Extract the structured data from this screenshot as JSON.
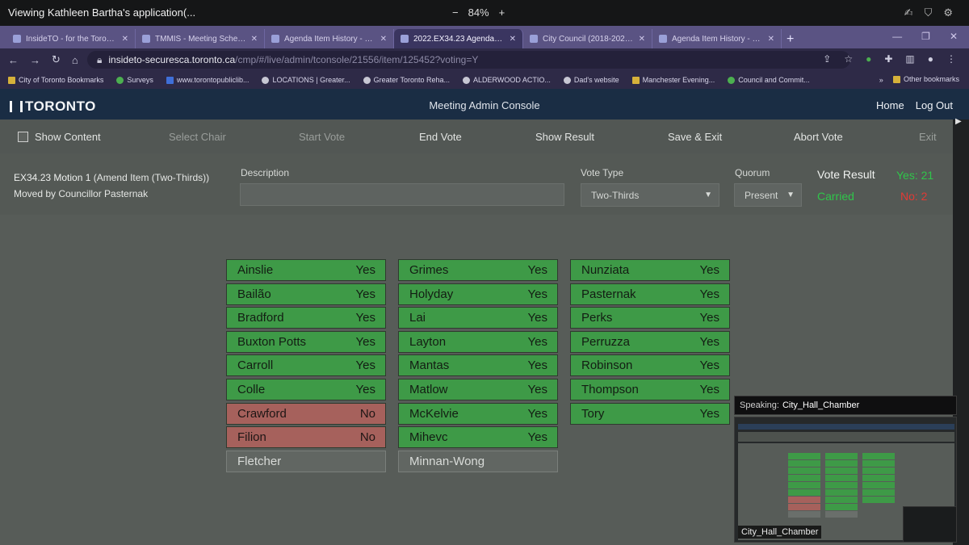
{
  "share_bar": {
    "title": "Viewing Kathleen Bartha's application(...",
    "zoom_minus": "−",
    "zoom_level": "84%",
    "zoom_plus": "+"
  },
  "tabs": [
    {
      "label": "InsideTO - for the Toronto P...",
      "active": false
    },
    {
      "label": "TMMIS - Meeting Schedule",
      "active": false
    },
    {
      "label": "Agenda Item History - 2022...",
      "active": false
    },
    {
      "label": "2022.EX34.23 Agenda Item...",
      "active": true
    },
    {
      "label": "City Council (2018-2022) -",
      "active": false
    },
    {
      "label": "Agenda Item History - 2022...",
      "active": false
    }
  ],
  "address": {
    "host": "insideto-securesca.toronto.ca",
    "path": "/cmp/#/live/admin/tconsole/21556/item/125452?voting=Y"
  },
  "bookmarks": [
    {
      "label": "City of Toronto Bookmarks",
      "icon": "folder-icon"
    },
    {
      "label": "Surveys",
      "icon": "globe-icon"
    },
    {
      "label": "www.torontopubliclib...",
      "icon": "library-icon"
    },
    {
      "label": "LOCATIONS | Greater...",
      "icon": "link-icon"
    },
    {
      "label": "Greater Toronto Reha...",
      "icon": "link-icon"
    },
    {
      "label": "ALDERWOOD ACTIO...",
      "icon": "link-icon"
    },
    {
      "label": "Dad's website",
      "icon": "globe-icon"
    },
    {
      "label": "Manchester Evening...",
      "icon": "news-icon"
    },
    {
      "label": "Council and Commit...",
      "icon": "globe-icon"
    }
  ],
  "bookmarks_more": "»",
  "other_bookmarks": "Other bookmarks",
  "header": {
    "logo": "TORONTO",
    "title": "Meeting Admin Console",
    "home": "Home",
    "logout": "Log Out"
  },
  "toolbar": {
    "show_content": "Show Content",
    "select_chair": "Select Chair",
    "start_vote": "Start Vote",
    "end_vote": "End Vote",
    "show_result": "Show Result",
    "save_exit": "Save & Exit",
    "abort_vote": "Abort Vote",
    "exit": "Exit"
  },
  "motion": {
    "id": "EX34.23 Motion 1",
    "type": "(Amend Item (Two-Thirds))",
    "moved_by": "Moved by Councillor Pasternak",
    "description_label": "Description",
    "description_value": "",
    "vote_type_label": "Vote Type",
    "vote_type_value": "Two-Thirds",
    "quorum_label": "Quorum",
    "quorum_value": "Present",
    "result_label": "Vote Result",
    "yes": "Yes: 21",
    "no": "No: 2",
    "status": "Carried"
  },
  "columns": [
    [
      {
        "name": "Ainslie",
        "vote": "Yes"
      },
      {
        "name": "Bailão",
        "vote": "Yes"
      },
      {
        "name": "Bradford",
        "vote": "Yes"
      },
      {
        "name": "Buxton Potts",
        "vote": "Yes"
      },
      {
        "name": "Carroll",
        "vote": "Yes"
      },
      {
        "name": "Colle",
        "vote": "Yes"
      },
      {
        "name": "Crawford",
        "vote": "No"
      },
      {
        "name": "Filion",
        "vote": "No"
      },
      {
        "name": "Fletcher",
        "vote": ""
      }
    ],
    [
      {
        "name": "Grimes",
        "vote": "Yes"
      },
      {
        "name": "Holyday",
        "vote": "Yes"
      },
      {
        "name": "Lai",
        "vote": "Yes"
      },
      {
        "name": "Layton",
        "vote": "Yes"
      },
      {
        "name": "Mantas",
        "vote": "Yes"
      },
      {
        "name": "Matlow",
        "vote": "Yes"
      },
      {
        "name": "McKelvie",
        "vote": "Yes"
      },
      {
        "name": "Mihevc",
        "vote": "Yes"
      },
      {
        "name": "Minnan-Wong",
        "vote": ""
      }
    ],
    [
      {
        "name": "Nunziata",
        "vote": "Yes"
      },
      {
        "name": "Pasternak",
        "vote": "Yes"
      },
      {
        "name": "Perks",
        "vote": "Yes"
      },
      {
        "name": "Perruzza",
        "vote": "Yes"
      },
      {
        "name": "Robinson",
        "vote": "Yes"
      },
      {
        "name": "Thompson",
        "vote": "Yes"
      },
      {
        "name": "Tory",
        "vote": "Yes"
      }
    ]
  ],
  "speaking": {
    "label": "Speaking:",
    "name": "City_Hall_Chamber",
    "thumb_label": "City_Hall_Chamber"
  },
  "colors": {
    "yes_cell": "#3e9a47",
    "no_cell": "#a6615c",
    "yes_text": "#2fc64a",
    "no_text": "#e03a35",
    "header_bg": "#1a2d44",
    "tab_strip": "#5a5383"
  }
}
